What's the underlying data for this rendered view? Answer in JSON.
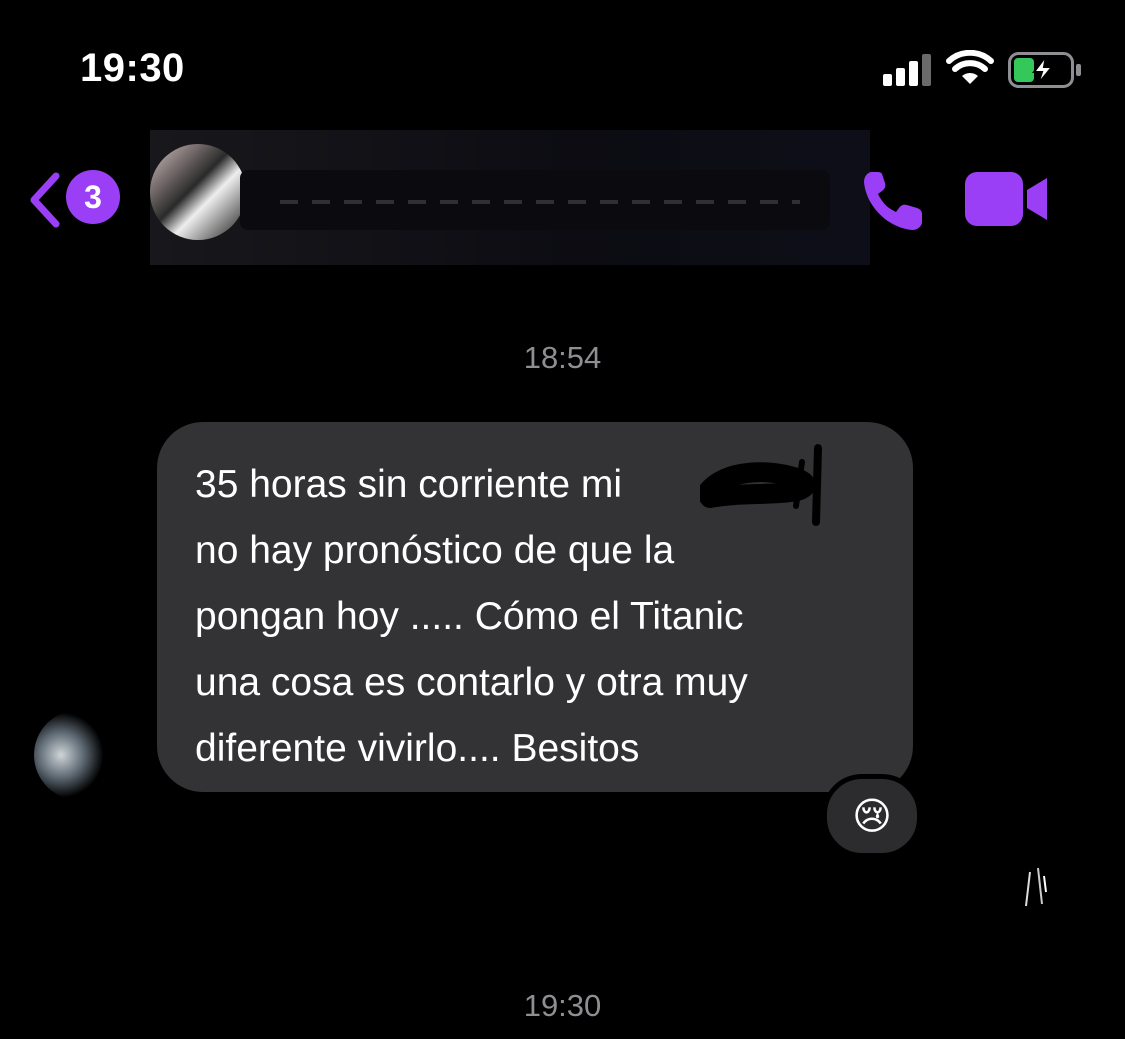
{
  "status_bar": {
    "time": "19:30",
    "signal_icon": "cellular-signal-icon",
    "wifi_icon": "wifi-icon",
    "battery_icon": "battery-charging-icon"
  },
  "header": {
    "back_icon": "chevron-left-icon",
    "unread_count": "3",
    "call_icon": "phone-icon",
    "video_icon": "video-camera-icon",
    "accent_color": "#9a3ff5"
  },
  "conversation": {
    "time_divider_1": "18:54",
    "message": {
      "text": "35 horas sin corriente mi         y\nno hay pronóstico de que la\npongan hoy ..... Cómo el Titanic\nuna cosa es contarlo y otra muy\ndiferente vivirlo.... Besitos",
      "reaction": "😢"
    },
    "time_divider_2": "19:30"
  }
}
